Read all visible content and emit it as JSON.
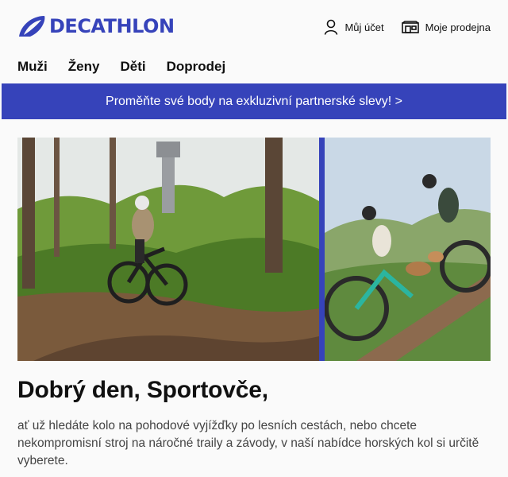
{
  "brand": {
    "name": "DECATHLON",
    "color": "#3643ba"
  },
  "header": {
    "account_label": "Můj účet",
    "account_icon": "person-icon",
    "store_label": "Moje prodejna",
    "store_icon": "store-icon"
  },
  "nav": {
    "items": [
      "Muži",
      "Ženy",
      "Děti",
      "Doprodej"
    ]
  },
  "promo": {
    "text": "Proměňte své body na exkluzivní partnerské slevy! >"
  },
  "hero": {
    "left_image": "mountain-biker-forest-trail-photo",
    "right_image": "cyclists-with-dogs-hill-photo"
  },
  "content": {
    "greeting": "Dobrý den, Sportovče,",
    "intro": "ať už hledáte kolo na pohodové vyjížďky po lesních cestách, nebo chcete nekompromisní stroj na náročné traily a závody, v naší nabídce horských kol si určitě vyberete."
  }
}
